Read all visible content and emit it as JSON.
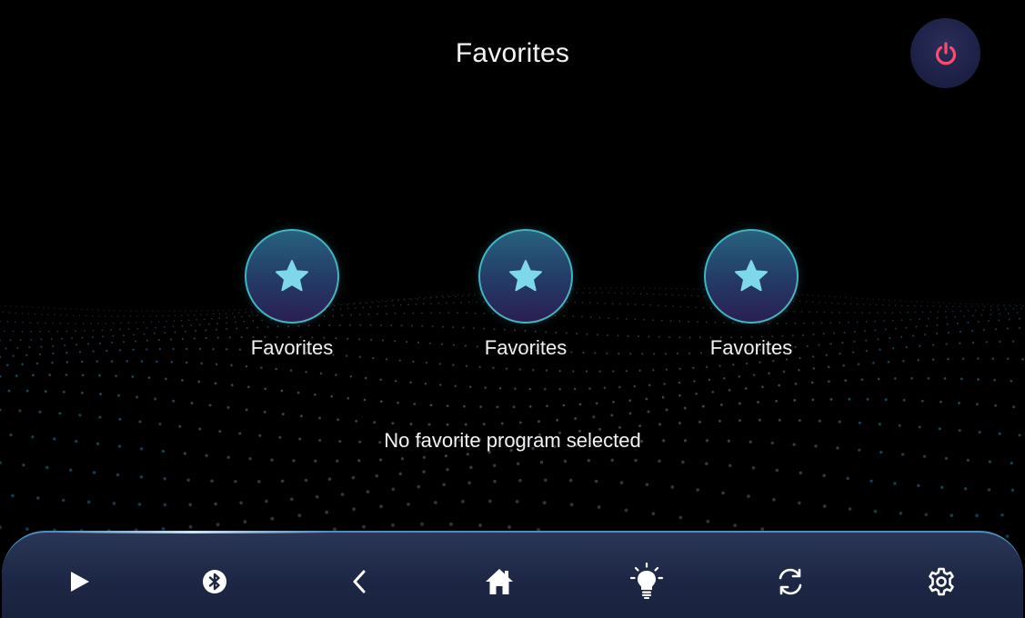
{
  "header": {
    "title": "Favorites",
    "power_icon": "power-icon",
    "power_color": "#ff4a6e"
  },
  "favorites": [
    {
      "label": "Favorites",
      "icon": "star-icon"
    },
    {
      "label": "Favorites",
      "icon": "star-icon"
    },
    {
      "label": "Favorites",
      "icon": "star-icon"
    }
  ],
  "status_text": "No favorite program selected",
  "navbar": {
    "items": [
      {
        "name": "play",
        "icon": "play-icon"
      },
      {
        "name": "bluetooth",
        "icon": "bluetooth-icon"
      },
      {
        "name": "back",
        "icon": "chevron-left-icon"
      },
      {
        "name": "home",
        "icon": "home-icon"
      },
      {
        "name": "light",
        "icon": "light-bulb-icon"
      },
      {
        "name": "sync",
        "icon": "sync-icon"
      },
      {
        "name": "settings",
        "icon": "gear-icon"
      }
    ]
  },
  "colors": {
    "accent": "#3fb6c2",
    "star": "#7fd8ea",
    "background": "#000000",
    "navbar": "#1d2745"
  }
}
